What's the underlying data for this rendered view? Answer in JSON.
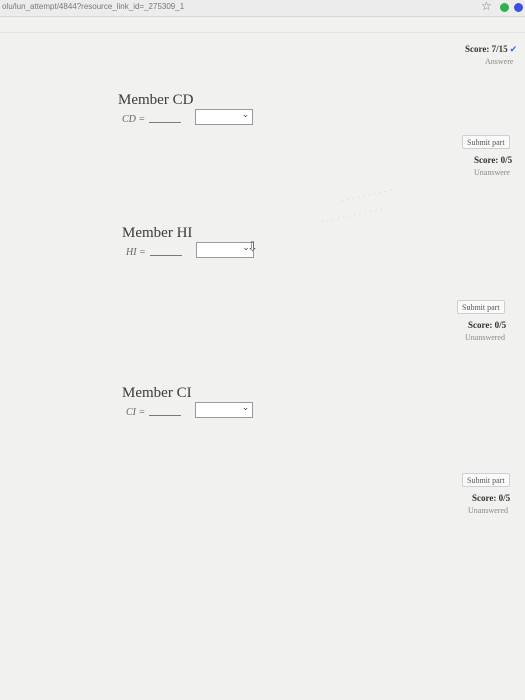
{
  "browser": {
    "url": "olu/lun_attempt/4844?resource_link_id=_275309_1",
    "bookmark_icon": "star-icon"
  },
  "members": [
    {
      "title": "Member CD",
      "label": "CD ="
    },
    {
      "title": "Member HI",
      "label": "HI ="
    },
    {
      "title": "Member CI",
      "label": "CI ="
    }
  ],
  "dropdown_icon": "chevron-down-icon",
  "sidebar": {
    "main_score": "Score: 7/15",
    "main_status": "Answere",
    "parts": [
      {
        "submit": "Submit part",
        "score": "Score: 0/5",
        "status": "Unanswere"
      },
      {
        "submit": "Submit part",
        "score": "Score: 0/5",
        "status": "Unanswered"
      },
      {
        "submit": "Submit part",
        "score": "Score: 0/5",
        "status": "Unanswered"
      }
    ]
  },
  "colors": {
    "accent": "#2e6fe0",
    "extension_green": "#2fb14a",
    "extension_blue": "#3c4fe0"
  }
}
